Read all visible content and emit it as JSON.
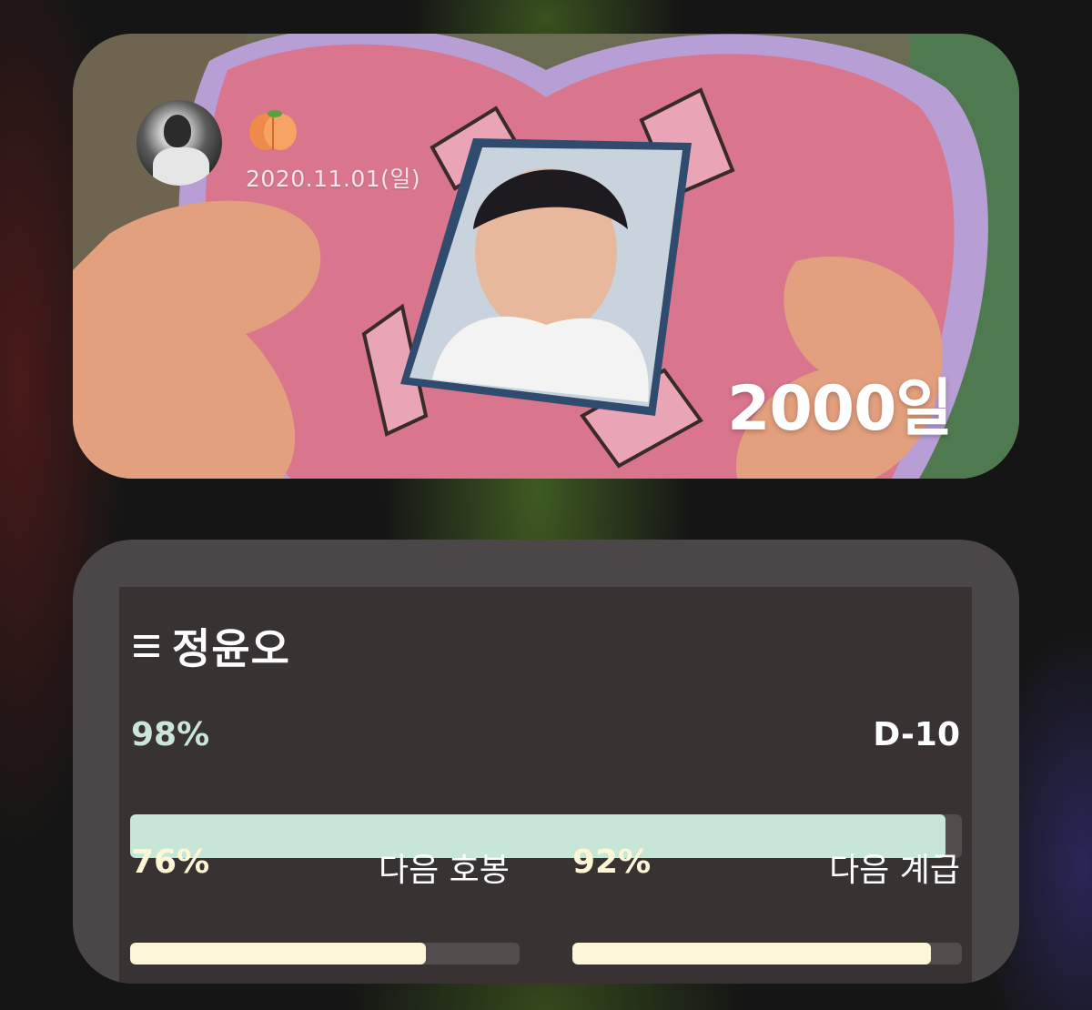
{
  "anniversary_widget": {
    "emoji": "🍑",
    "date": "2020.11.01(일)",
    "days": "2000일"
  },
  "progress_widget": {
    "title": "정윤오",
    "main": {
      "percent_label": "98%",
      "percent": 98,
      "right_label": "D-10"
    },
    "next_step": {
      "percent_label": "76%",
      "percent": 76,
      "label": "다음 호봉"
    },
    "next_rank": {
      "percent_label": "92%",
      "percent": 92,
      "label": "다음 계급"
    },
    "colors": {
      "main_bar": "#c8e6d8",
      "sub_bar": "#fdf7d8",
      "track": "#524c4d",
      "panel": "#383233"
    }
  }
}
